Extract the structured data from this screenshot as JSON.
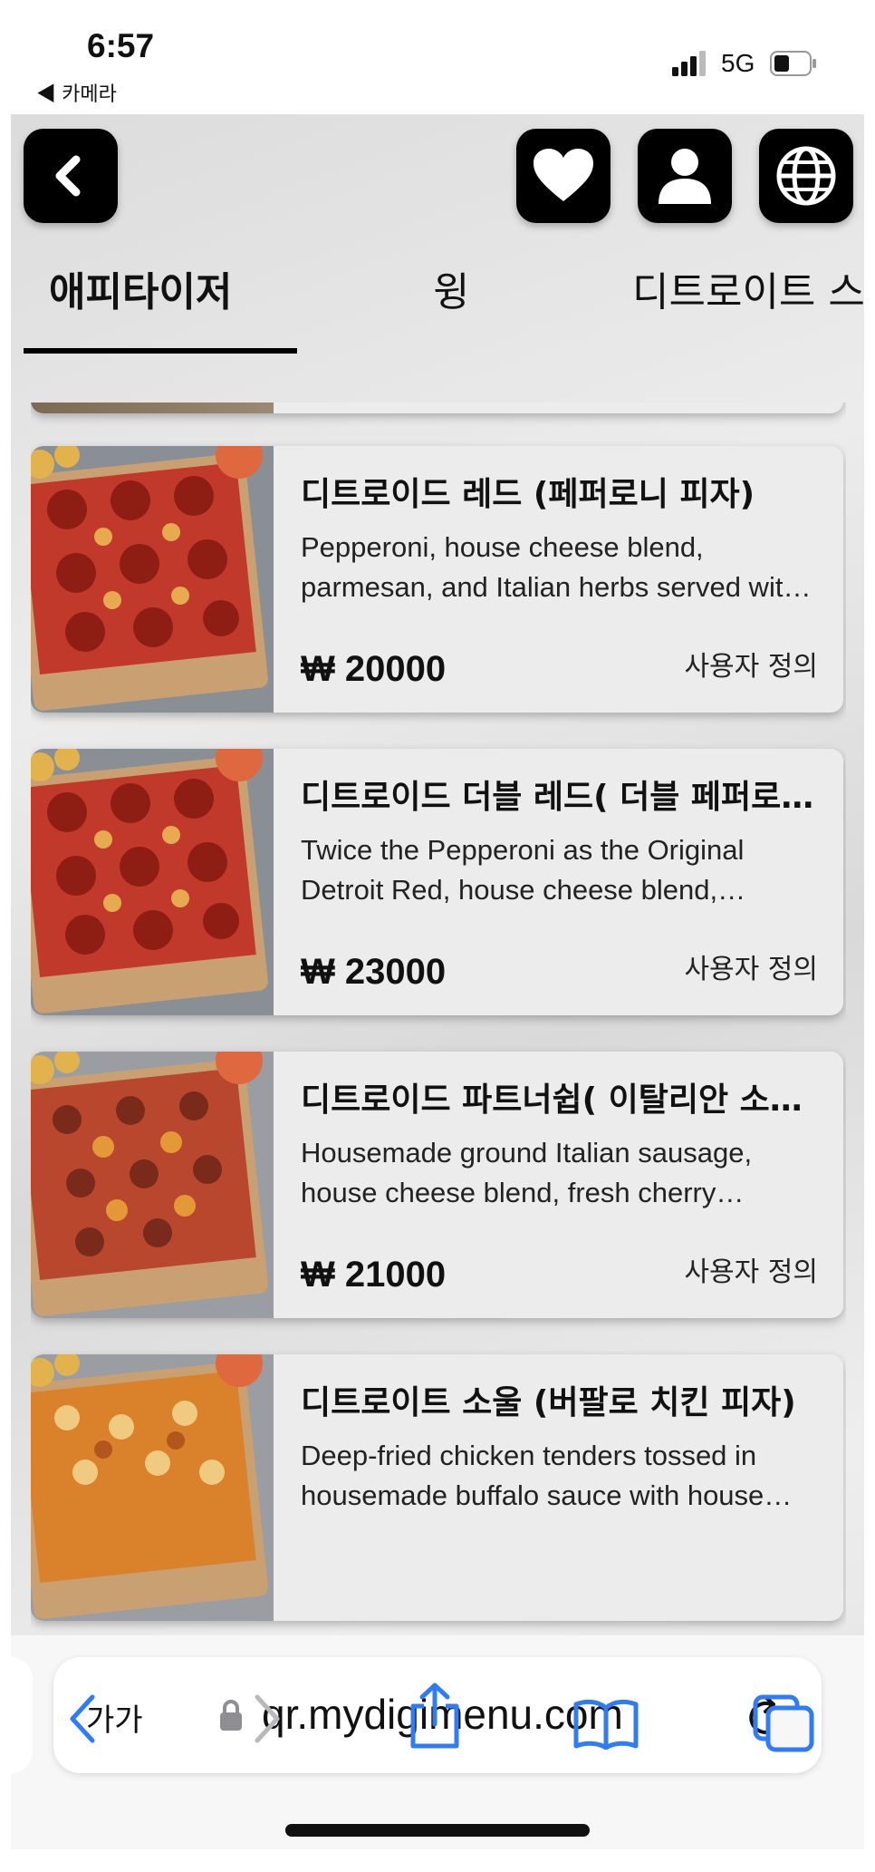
{
  "status_bar": {
    "time": "6:57",
    "back_app": "◀ 카메라",
    "network": "5G"
  },
  "tabs": [
    {
      "label": "애피타이저",
      "active": true
    },
    {
      "label": "윙",
      "active": false
    },
    {
      "label": "디트로이트 스",
      "active": false
    }
  ],
  "menu_items": [
    {
      "name": "디트로이드 레드 (페퍼로니 피자)",
      "description": "Pepperoni, house cheese blend, parmesan, and Italian herbs served with a side of red sauce",
      "price": "₩ 20000",
      "custom_label": "사용자 정의"
    },
    {
      "name": "디트로이드 더블 레드( 더블 페퍼로니 피자)",
      "description": "Twice the Pepperoni as the Original Detroit Red, house cheese blend, parmesan and Italian herbs",
      "price": "₩ 23000",
      "custom_label": "사용자 정의"
    },
    {
      "name": "디트로이드 파트너쉽( 이탈리안 소시지 피자)",
      "description": "Housemade ground Italian sausage, house cheese blend, fresh cherry peppers and red sauce",
      "price": "₩ 21000",
      "custom_label": "사용자 정의"
    },
    {
      "name": "디트로이트 소울 (버팔로 치킨 피자)",
      "description": "Deep-fried chicken tenders tossed in housemade buffalo sauce with house cheese blend",
      "price": "",
      "custom_label": ""
    }
  ],
  "browser": {
    "text_size_label": "가가",
    "url": "qr.mydigimenu.com"
  },
  "colors": {
    "safari_blue": "#2f7cf6",
    "button_black": "#000000",
    "card_bg": "#ececec"
  },
  "icons": [
    "back-icon",
    "heart-icon",
    "user-icon",
    "globe-icon",
    "lock-icon",
    "reload-icon",
    "share-icon",
    "bookmarks-icon",
    "tabs-icon"
  ]
}
